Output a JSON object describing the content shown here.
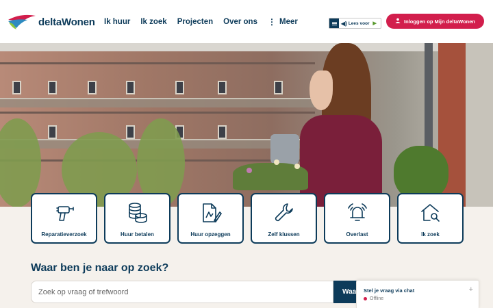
{
  "brand": {
    "name": "deltaWonen"
  },
  "nav": {
    "items": [
      "Ik huur",
      "Ik zoek",
      "Projecten",
      "Over ons",
      "Meer"
    ]
  },
  "readspeaker": {
    "label": "Lees voor"
  },
  "login": {
    "label": "Inloggen op Mijn deltaWonen"
  },
  "tiles": [
    {
      "label": "Reparatieverzoek",
      "icon": "drill-icon"
    },
    {
      "label": "Huur betalen",
      "icon": "coins-icon"
    },
    {
      "label": "Huur opzeggen",
      "icon": "document-sign-icon"
    },
    {
      "label": "Zelf klussen",
      "icon": "wrench-icon"
    },
    {
      "label": "Overlast",
      "icon": "alarm-bell-icon"
    },
    {
      "label": "Ik zoek",
      "icon": "house-search-icon"
    }
  ],
  "search": {
    "title": "Waar ben je naar op zoek?",
    "placeholder": "Zoek op vraag of trefwoord",
    "button_label": "Waar"
  },
  "chat": {
    "title": "Stel je vraag via chat",
    "status": "Offline"
  },
  "colors": {
    "primary": "#0d3b5a",
    "accent": "#d21e4c",
    "background": "#f5f1ec"
  }
}
